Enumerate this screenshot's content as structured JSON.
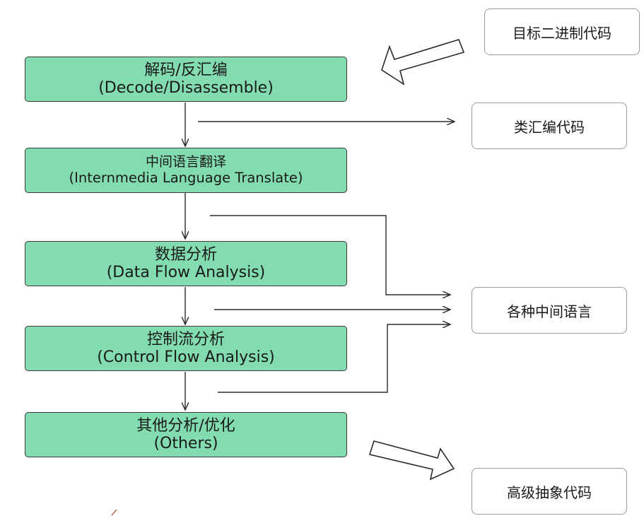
{
  "stages": [
    {
      "zh": "解码/反汇编",
      "en": "(Decode/Disassemble)"
    },
    {
      "zh": "中间语言翻译",
      "en": "(Internmedia Language Translate)"
    },
    {
      "zh": "数据分析",
      "en": "(Data Flow Analysis)"
    },
    {
      "zh": "控制流分析",
      "en": "(Control Flow Analysis)"
    },
    {
      "zh": "其他分析/优化",
      "en": "(Others)"
    }
  ],
  "outputs": {
    "binary": "目标二进制代码",
    "asm_like": "类汇编代码",
    "intermediate": "各种中间语言",
    "high_level": "高级抽象代码"
  },
  "colors": {
    "stage_fill": "#82dcb0",
    "stage_border": "#3a3a3a",
    "line": "#2a2a2a"
  }
}
